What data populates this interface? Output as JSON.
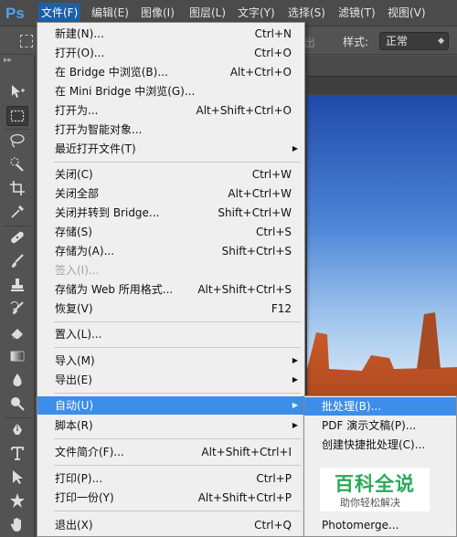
{
  "app": {
    "logo": "Ps"
  },
  "menubar": {
    "items": [
      {
        "label": "文件(F)"
      },
      {
        "label": "编辑(E)"
      },
      {
        "label": "图像(I)"
      },
      {
        "label": "图层(L)"
      },
      {
        "label": "文字(Y)"
      },
      {
        "label": "选择(S)"
      },
      {
        "label": "滤镜(T)"
      },
      {
        "label": "视图(V)"
      }
    ]
  },
  "options": {
    "faded_label": "出",
    "style_label": "样式:",
    "style_value": "正常"
  },
  "file_menu": {
    "items": [
      {
        "label": "新建(N)...",
        "shortcut": "Ctrl+N"
      },
      {
        "label": "打开(O)...",
        "shortcut": "Ctrl+O"
      },
      {
        "label": "在 Bridge 中浏览(B)...",
        "shortcut": "Alt+Ctrl+O"
      },
      {
        "label": "在 Mini Bridge 中浏览(G)...",
        "shortcut": ""
      },
      {
        "label": "打开为...",
        "shortcut": "Alt+Shift+Ctrl+O"
      },
      {
        "label": "打开为智能对象...",
        "shortcut": ""
      },
      {
        "label": "最近打开文件(T)",
        "shortcut": "",
        "submenu": "▶"
      },
      {
        "label": "关闭(C)",
        "shortcut": "Ctrl+W"
      },
      {
        "label": "关闭全部",
        "shortcut": "Alt+Ctrl+W"
      },
      {
        "label": "关闭并转到 Bridge...",
        "shortcut": "Shift+Ctrl+W"
      },
      {
        "label": "存储(S)",
        "shortcut": "Ctrl+S"
      },
      {
        "label": "存储为(A)...",
        "shortcut": "Shift+Ctrl+S"
      },
      {
        "label": "签入(I)...",
        "shortcut": "",
        "disabled": true
      },
      {
        "label": "存储为 Web 所用格式...",
        "shortcut": "Alt+Shift+Ctrl+S"
      },
      {
        "label": "恢复(V)",
        "shortcut": "F12"
      },
      {
        "label": "置入(L)...",
        "shortcut": ""
      },
      {
        "label": "导入(M)",
        "shortcut": "",
        "submenu": "▶"
      },
      {
        "label": "导出(E)",
        "shortcut": "",
        "submenu": "▶"
      },
      {
        "label": "自动(U)",
        "shortcut": "",
        "submenu": "▶",
        "highlighted": true
      },
      {
        "label": "脚本(R)",
        "shortcut": "",
        "submenu": "▶"
      },
      {
        "label": "文件简介(F)...",
        "shortcut": "Alt+Shift+Ctrl+I"
      },
      {
        "label": "打印(P)...",
        "shortcut": "Ctrl+P"
      },
      {
        "label": "打印一份(Y)",
        "shortcut": "Alt+Shift+Ctrl+P"
      },
      {
        "label": "退出(X)",
        "shortcut": "Ctrl+Q"
      }
    ]
  },
  "automate_submenu": {
    "items": [
      {
        "label": "批处理(B)...",
        "highlighted": true
      },
      {
        "label": "PDF 演示文稿(P)..."
      },
      {
        "label": "创建快捷批处理(C)..."
      },
      {
        "label": "Photomerge..."
      }
    ]
  },
  "watermark": {
    "title": "百科全说",
    "subtitle": "助你轻松解决"
  },
  "colors": {
    "menu_highlight": "#3d8ee8",
    "menubar_active": "#1c5fa8",
    "ps_blue": "#4fa3e8"
  }
}
